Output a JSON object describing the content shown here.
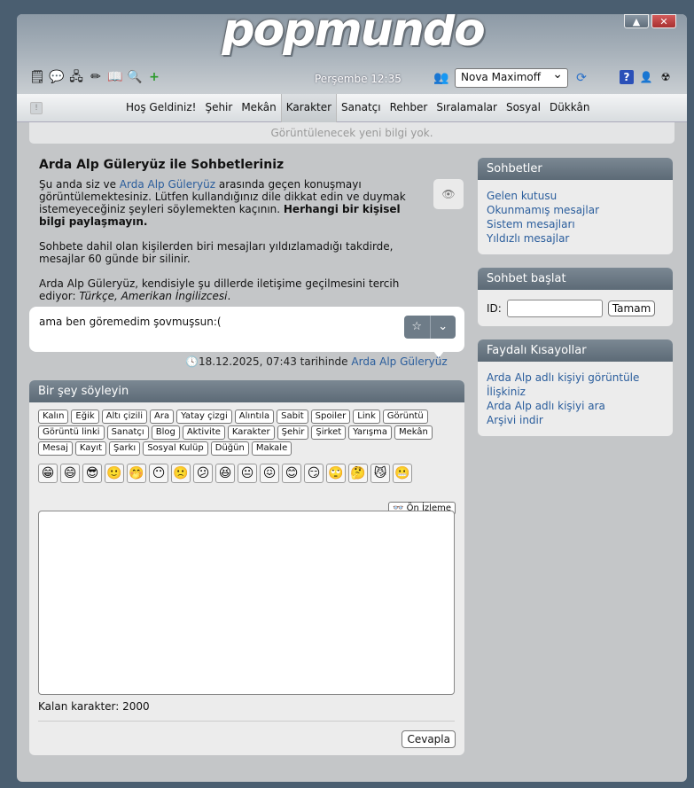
{
  "header": {
    "logo": "popmundo",
    "clock": "Perşembe 12:35",
    "character": "Nova Maximoff",
    "window_min": "▲",
    "window_close": "✕"
  },
  "nav": {
    "toggle": "!",
    "items": [
      "Hoş Geldiniz!",
      "Şehir",
      "Mekân",
      "Karakter",
      "Sanatçı",
      "Rehber",
      "Sıralamalar",
      "Sosyal",
      "Dükkân"
    ],
    "active": "Karakter"
  },
  "notice": "Görüntülenecek yeni bilgi yok.",
  "conversation": {
    "title": "Arda Alp Güleryüz ile Sohbetleriniz",
    "intro_pre": "Şu anda siz ve ",
    "intro_link": "Arda Alp Güleryüz",
    "intro_post": " arasında geçen konuşmayı görüntülemektesiniz. Lütfen kullandığınız dile dikkat edin ve duymak istemeyeceğiniz şeyleri söylemekten kaçının. ",
    "intro_bold": "Herhangi bir kişisel bilgi paylaşmayın.",
    "delete_note": "Sohbete dahil olan kişilerden biri mesajları yıldızlamadığı takdirde, mesajlar 60 günde bir silinir.",
    "lang_pre": "Arda Alp Güleryüz, kendisiyle şu dillerde iletişime geçilmesini tercih ediyor: ",
    "lang_list": "Türkçe, Amerikan İngilizcesi",
    "lang_post": "."
  },
  "message": {
    "text": "ama ben göremedim şovmuşsun:(",
    "timestamp": "18.12.2025, 07:43 tarihinde",
    "author": "Arda Alp Güleryüz"
  },
  "say": {
    "title": "Bir şey söyleyin",
    "format_buttons": [
      "Kalın",
      "Eğik",
      "Altı çizili",
      "Ara",
      "Yatay çizgi",
      "Alıntıla",
      "Sabit",
      "Spoiler",
      "Link",
      "Görüntü",
      "Görüntü linki",
      "Sanatçı",
      "Blog",
      "Aktivite",
      "Karakter",
      "Şehir",
      "Şirket",
      "Yarışma",
      "Mekân",
      "Mesaj",
      "Kayıt",
      "Şarkı",
      "Sosyal Kulüp",
      "Düğün",
      "Makale"
    ],
    "smileys": [
      "😁",
      "😄",
      "😎",
      "🙂",
      "🤭",
      "😶",
      "🙁",
      "😕",
      "😆",
      "😐",
      "😖",
      "😊",
      "😏",
      "🙄",
      "🤔",
      "😼",
      "😬"
    ],
    "preview": "Ön İzleme",
    "remaining_label": "Kalan karakter: 2000",
    "reply": "Cevapla"
  },
  "sidebar": {
    "chats_title": "Sohbetler",
    "chats_links": [
      "Gelen kutusu",
      "Okunmamış mesajlar",
      "Sistem mesajları",
      "Yıldızlı mesajlar"
    ],
    "start_title": "Sohbet başlat",
    "id_label": "ID:",
    "ok": "Tamam",
    "shortcuts_title": "Faydalı Kısayollar",
    "shortcut_links": [
      "Arda Alp adlı kişiyi görüntüle",
      "İlişkiniz",
      "Arda Alp adlı kişiyi ara",
      "Arşivi indir"
    ]
  },
  "colors": {
    "link": "#2a5d9c",
    "panel_header": "#6e7c88",
    "page_bg": "#4a5e70"
  }
}
